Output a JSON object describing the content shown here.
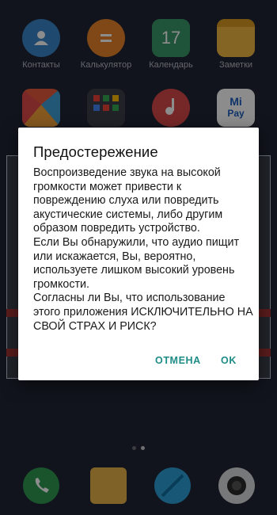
{
  "home": {
    "apps": [
      {
        "label": "Контакты",
        "icon": "contacts-icon"
      },
      {
        "label": "Калькулятор",
        "icon": "calculator-icon"
      },
      {
        "label": "Календарь",
        "icon": "calendar-icon",
        "day": "17"
      },
      {
        "label": "Заметки",
        "icon": "notes-icon"
      }
    ],
    "row2_icons": [
      "gallery-icon",
      "google-folder-icon",
      "music-icon",
      "mi-pay-icon"
    ],
    "mi_pay": {
      "top": "Mi",
      "bottom": "Pay"
    },
    "dock_icons": [
      "phone-icon",
      "messages-icon",
      "browser-icon",
      "camera-icon"
    ]
  },
  "dialog": {
    "title": "Предостережение",
    "message": [
      "Воспроизведение звука на высокой громкости может привести к повреждению слуха или повредить акустические системы, либо другим образом повредить устройство.",
      "Если Вы обнаружили, что аудио пищит или искажается, Вы, вероятно, используете лишком высокий уровень громкости.",
      "Согласны ли Вы, что использование этого приложения ИСКЛЮЧИТЕЛЬНО НА СВОЙ СТРАХ И РИСК?"
    ],
    "cancel_label": "ОТМЕНА",
    "ok_label": "OK"
  },
  "colors": {
    "background": "#202633",
    "accent": "#1e8c86",
    "contacts": "#3a86c8",
    "calculator": "#e9832b",
    "calendar": "#3a9a6a",
    "notes": "#f0b840",
    "music": "#d84848",
    "phone": "#2e9a52",
    "messages": "#e8b24a",
    "browser": "#2c9fd6"
  },
  "page_indicator": {
    "pages": 2,
    "active": 1
  }
}
